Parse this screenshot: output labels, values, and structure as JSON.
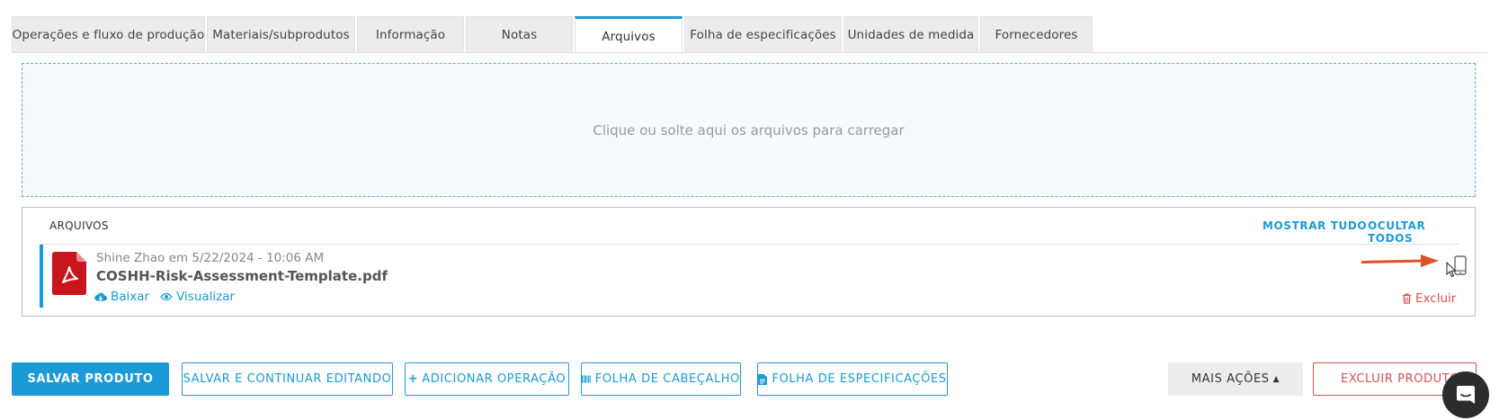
{
  "tabs": [
    {
      "label": "Operações e fluxo de produção",
      "active": false
    },
    {
      "label": "Materiais/subprodutos",
      "active": false
    },
    {
      "label": "Informação",
      "active": false
    },
    {
      "label": "Notas",
      "active": false
    },
    {
      "label": "Arquivos",
      "active": true
    },
    {
      "label": "Folha de especificações",
      "active": false
    },
    {
      "label": "Unidades de medida",
      "active": false
    },
    {
      "label": "Fornecedores",
      "active": false
    }
  ],
  "dropzone": {
    "text": "Clique ou solte aqui os arquivos para carregar"
  },
  "files": {
    "title": "ARQUIVOS",
    "show_all": "MOSTRAR TUDO",
    "hide_all": "OCULTAR TODOS",
    "items": [
      {
        "meta": "Shine Zhao em 5/22/2024 - 10:06 AM",
        "name": "COSHH-Risk-Assessment-Template.pdf",
        "download": "Baixar",
        "view": "Visualizar",
        "delete": "Excluir",
        "icon": "pdf-file-icon"
      }
    ]
  },
  "buttons": {
    "save_product": "SALVAR PRODUTO",
    "save_continue": "SALVAR E CONTINUAR EDITANDO",
    "add_operation": "ADICIONAR OPERAÇÃO",
    "header_sheet": "FOLHA DE CABEÇALHO",
    "spec_sheet": "FOLHA DE ESPECIFICAÇÕES",
    "more_actions": "MAIS AÇÕES",
    "delete_product": "EXCLUIR PRODUTO"
  },
  "colors": {
    "accent": "#1a9bd7",
    "danger": "#d9534f",
    "pdf": "#c8161d",
    "annotation": "#e0502a"
  }
}
